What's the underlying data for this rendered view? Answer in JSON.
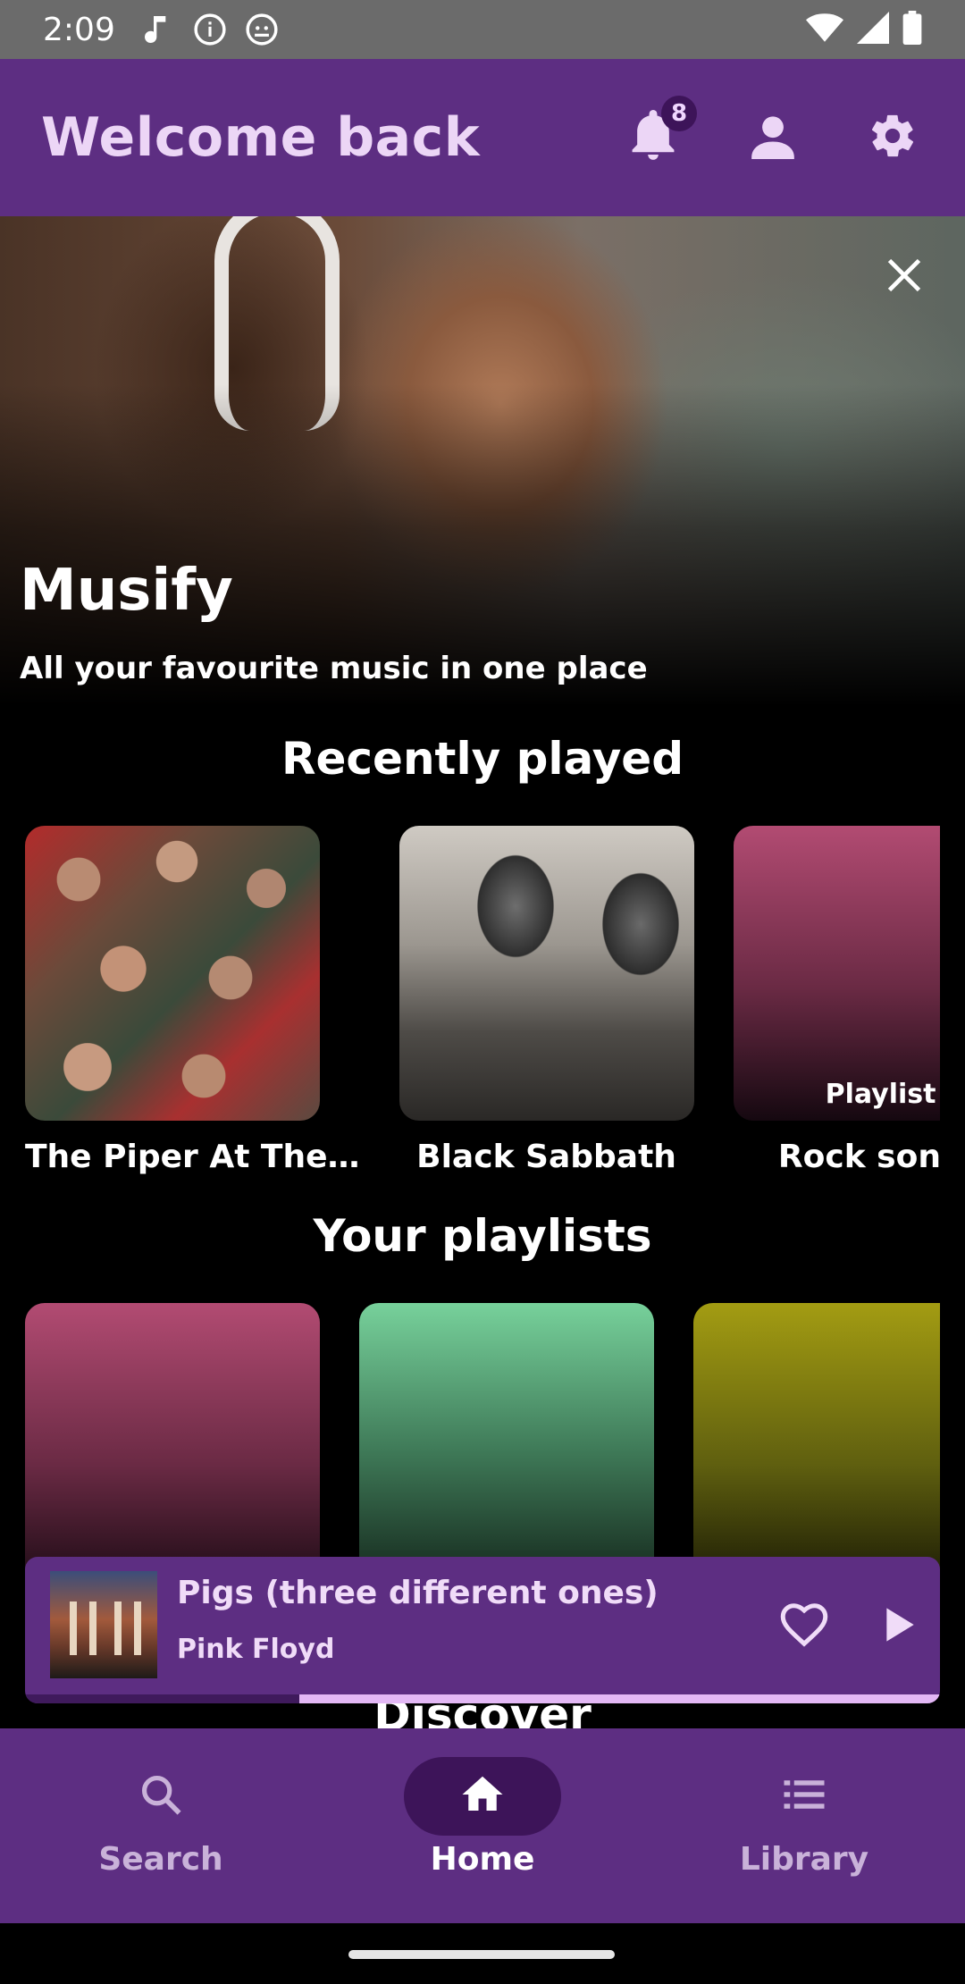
{
  "status_bar": {
    "time": "2:09",
    "icons": [
      "music-note-icon",
      "info-icon",
      "android-icon"
    ],
    "right_icons": [
      "wifi-icon",
      "signal-icon",
      "battery-icon"
    ]
  },
  "app_bar": {
    "title": "Welcome back",
    "notification_count": "8",
    "actions": [
      "bell-icon",
      "account-icon",
      "settings-icon"
    ]
  },
  "hero": {
    "title": "Musify",
    "subtitle": "All your favourite music in one place",
    "close_icon": "close-icon"
  },
  "recently_played": {
    "title": "Recently played",
    "items": [
      {
        "label": "The Piper At The…",
        "art": "album-cover"
      },
      {
        "label": "Black Sabbath",
        "art": "artist-photo"
      },
      {
        "label": "Rock songs",
        "tag": "Playlist",
        "art": "gradient-rose"
      }
    ]
  },
  "playlists": {
    "title": "Your playlists",
    "items": [
      {
        "art": "gradient-rose"
      },
      {
        "art": "gradient-green"
      },
      {
        "art": "gradient-olive"
      }
    ]
  },
  "discover": {
    "title": "Discover"
  },
  "mini_player": {
    "title": "Pigs (three different ones)",
    "artist": "Pink Floyd",
    "progress": 0.3
  },
  "bottom_nav": {
    "items": [
      {
        "label": "Search",
        "icon": "search-icon",
        "active": false
      },
      {
        "label": "Home",
        "icon": "home-icon",
        "active": true
      },
      {
        "label": "Library",
        "icon": "library-icon",
        "active": false
      }
    ]
  },
  "colors": {
    "primary": "#5d2e82",
    "primary_dark": "#3d1459",
    "title_tint": "#ecd6f6",
    "progress": "#e3b8f5"
  }
}
